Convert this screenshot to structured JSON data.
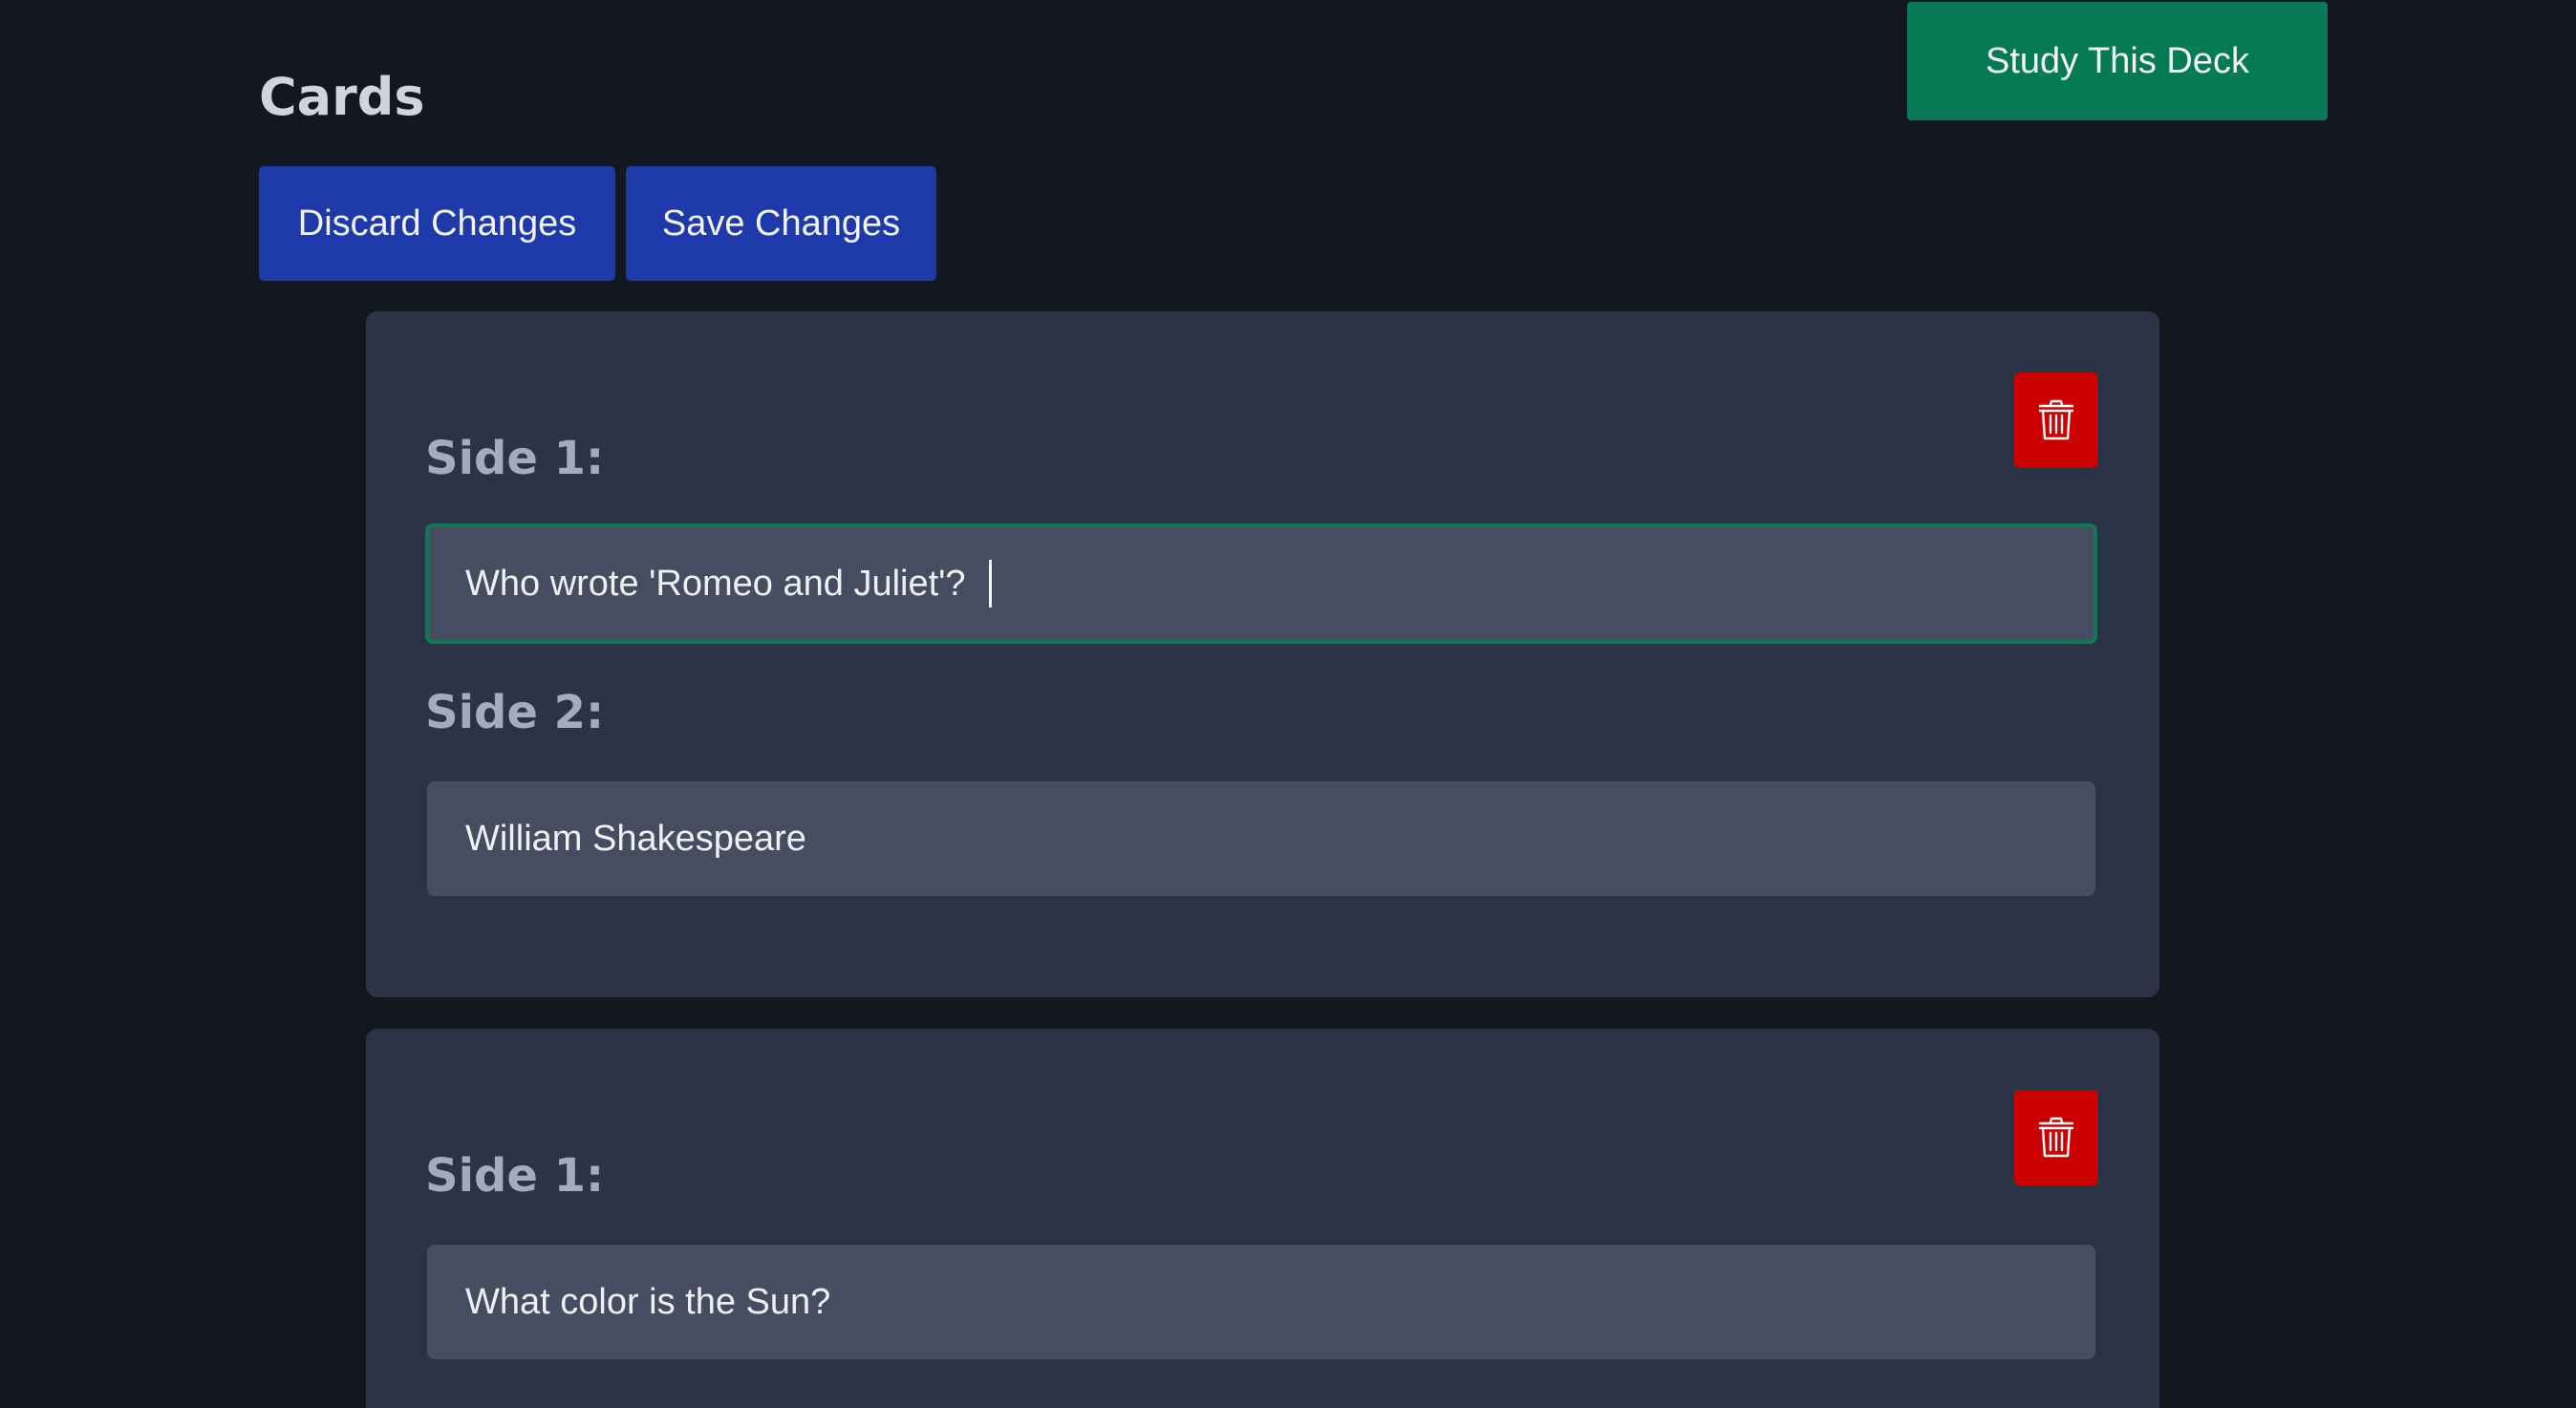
{
  "header": {
    "title": "Cards",
    "study_label": "Study This Deck",
    "discard_label": "Discard Changes",
    "save_label": "Save Changes"
  },
  "cards": [
    {
      "side1_label": "Side 1:",
      "side1_value": "Who wrote 'Romeo and Juliet'?",
      "side2_label": "Side 2:",
      "side2_value": "William Shakespeare",
      "delete_icon": "trash-icon"
    },
    {
      "side1_label": "Side 1:",
      "side1_value": "What color is the Sun?",
      "delete_icon": "trash-icon"
    }
  ],
  "colors": {
    "background": "#131720",
    "card": "#2b3446",
    "input": "#464d60",
    "primary_button": "#1e3aaa",
    "study_button": "#057a55",
    "delete_button": "#cc0000",
    "focus_border": "#0d7a55"
  }
}
